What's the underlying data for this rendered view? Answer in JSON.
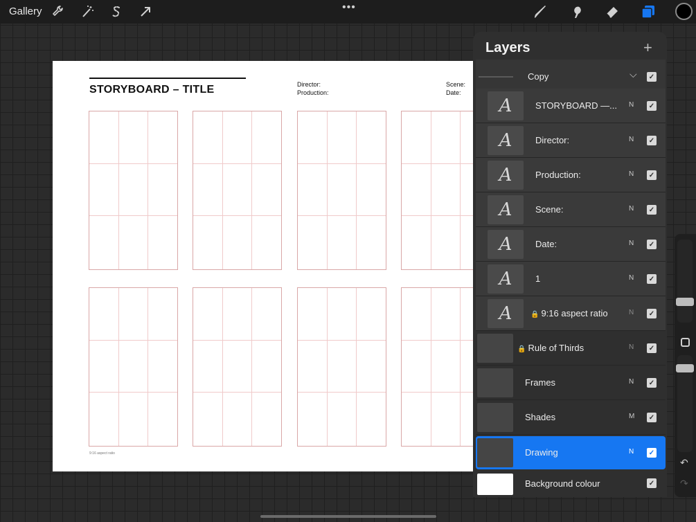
{
  "toolbar": {
    "gallery_label": "Gallery",
    "more_label": "•••",
    "tools_left": [
      "wrench-icon",
      "magic-wand-icon",
      "selection-icon",
      "transform-arrow-icon"
    ],
    "tools_right": [
      "brush-icon",
      "smudge-icon",
      "eraser-icon",
      "layers-icon"
    ],
    "active_color": "#000000",
    "accent_color": "#1677f2"
  },
  "document": {
    "title": "STORYBOARD – TITLE",
    "director_label": "Director:",
    "production_label": "Production:",
    "scene_label": "Scene:",
    "date_label": "Date:",
    "footer_note": "9:16 aspect ratio"
  },
  "layers_panel": {
    "title": "Layers",
    "add_label": "+",
    "group": {
      "name": "Copy",
      "chevron": "⌵",
      "visible": true
    },
    "layers": [
      {
        "name": "STORYBOARD —...",
        "blend": "N",
        "thumb": "A",
        "visible": true
      },
      {
        "name": "Director:",
        "blend": "N",
        "thumb": "A",
        "visible": true
      },
      {
        "name": "Production:",
        "blend": "N",
        "thumb": "A",
        "visible": true
      },
      {
        "name": "Scene:",
        "blend": "N",
        "thumb": "A",
        "visible": true
      },
      {
        "name": "Date:",
        "blend": "N",
        "thumb": "A",
        "visible": true
      },
      {
        "name": "1",
        "blend": "N",
        "thumb": "A",
        "visible": true
      },
      {
        "name": "9:16 aspect ratio",
        "blend": "N",
        "thumb": "A",
        "locked": true,
        "visible": true
      },
      {
        "name": "Rule of Thirds",
        "blend": "N",
        "locked": true,
        "visible": true
      },
      {
        "name": "Frames",
        "blend": "N",
        "visible": true
      },
      {
        "name": "Shades",
        "blend": "M",
        "visible": true
      },
      {
        "name": "Drawing",
        "blend": "N",
        "visible": true,
        "selected": true
      },
      {
        "name": "Background colour",
        "visible": true
      }
    ],
    "check_glyph": "✓",
    "lock_glyph": "🔒"
  },
  "sidebar": {
    "undo_label": "↶",
    "redo_label": "↷"
  }
}
